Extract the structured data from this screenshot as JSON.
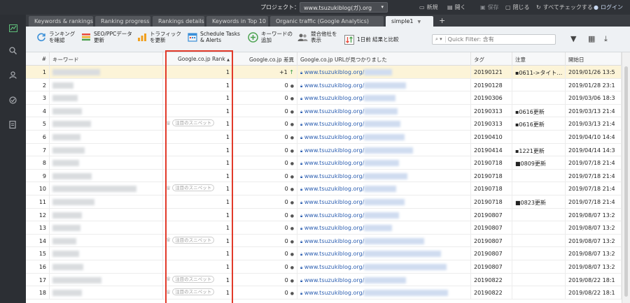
{
  "header": {
    "project_label": "プロジェクト：",
    "project_value": "www.tsuzukiblog(ガ).org",
    "buttons": [
      {
        "icon": "new-icon",
        "label": "新規"
      },
      {
        "icon": "open-icon",
        "label": "開く"
      },
      {
        "icon": "save-icon",
        "label": "保存"
      },
      {
        "icon": "close-icon",
        "label": "閉じる"
      },
      {
        "icon": "refresh-icon",
        "label": "すべてチェックする"
      },
      {
        "icon": "user-icon",
        "label": "ログイン"
      }
    ]
  },
  "sidebar": {
    "items": [
      {
        "icon": "chart-icon",
        "active": true
      },
      {
        "icon": "search-icon",
        "active": false
      },
      {
        "icon": "person-icon",
        "active": false
      },
      {
        "icon": "check-circle-icon",
        "active": false
      },
      {
        "icon": "document-icon",
        "active": false
      }
    ]
  },
  "tabs": [
    {
      "label": "Keywords & rankings",
      "active": false
    },
    {
      "label": "Ranking progress",
      "active": false
    },
    {
      "label": "Rankings details",
      "active": false
    },
    {
      "label": "Keywords in Top 10",
      "active": false
    },
    {
      "label": "Organic traffic (Google Analytics)",
      "active": false
    },
    {
      "label": "simple1",
      "active": true
    }
  ],
  "toolbar": {
    "buttons": [
      {
        "icon": "refresh-icon",
        "line1": "ランキング",
        "line2": "を確認"
      },
      {
        "icon": "seo-data-icon",
        "line1": "SEO/PPCデータ",
        "line2": "更新"
      },
      {
        "icon": "traffic-icon",
        "line1": "トラフィック",
        "line2": "を更新"
      },
      {
        "icon": "calendar-icon",
        "line1": "Schedule Tasks",
        "line2": "& Alerts"
      },
      {
        "icon": "add-keyword-icon",
        "line1": "キーワードの",
        "line2": "追加"
      },
      {
        "icon": "competitors-icon",
        "line1": "競合他社を",
        "line2": "表示"
      },
      {
        "icon": "compare-icon",
        "line1": "1日前 結果と比較",
        "line2": ""
      }
    ],
    "filter_mode": "",
    "filter_placeholder": "Quick Filter: 含有"
  },
  "table": {
    "columns": [
      "#",
      "キーワード",
      "Google.co.jp Rank",
      "Google.co.jp 差異",
      "Google.co.jp URLが見つかりました",
      "タグ",
      "注意",
      "開始日"
    ],
    "sort_indicator": "▲",
    "snippet_label": "注目のスニペット",
    "url_prefix": "www.tsuzukiblog.org/",
    "rows": [
      {
        "n": "1",
        "rank": "1",
        "diff": "+1",
        "up": true,
        "snippet": false,
        "tag": "20190121",
        "note": "▪0611->タイト…",
        "date": "2019/01/26 13:5"
      },
      {
        "n": "2",
        "rank": "1",
        "diff": "0",
        "up": false,
        "snippet": false,
        "tag": "20190128",
        "note": "",
        "date": "2019/01/28 23:1"
      },
      {
        "n": "3",
        "rank": "1",
        "diff": "0",
        "up": false,
        "snippet": false,
        "tag": "20190306",
        "note": "",
        "date": "2019/03/06 18:3"
      },
      {
        "n": "4",
        "rank": "1",
        "diff": "0",
        "up": false,
        "snippet": false,
        "tag": "20190313",
        "note": "▪0616更新",
        "date": "2019/03/13 21:4"
      },
      {
        "n": "5",
        "rank": "1",
        "diff": "0",
        "up": false,
        "snippet": true,
        "tag": "20190313",
        "note": "▪0616更新",
        "date": "2019/03/13 21:4"
      },
      {
        "n": "6",
        "rank": "1",
        "diff": "0",
        "up": false,
        "snippet": false,
        "tag": "20190410",
        "note": "",
        "date": "2019/04/10 14:4"
      },
      {
        "n": "7",
        "rank": "1",
        "diff": "0",
        "up": false,
        "snippet": false,
        "tag": "20190414",
        "note": "▪1221更新",
        "date": "2019/04/14 14:3"
      },
      {
        "n": "8",
        "rank": "1",
        "diff": "0",
        "up": false,
        "snippet": false,
        "tag": "20190718",
        "note": "■0809更新",
        "date": "2019/07/18 21:4"
      },
      {
        "n": "9",
        "rank": "1",
        "diff": "0",
        "up": false,
        "snippet": false,
        "tag": "20190718",
        "note": "",
        "date": "2019/07/18 21:4"
      },
      {
        "n": "10",
        "rank": "1",
        "diff": "0",
        "up": false,
        "snippet": true,
        "tag": "20190718",
        "note": "",
        "date": "2019/07/18 21:4"
      },
      {
        "n": "11",
        "rank": "1",
        "diff": "0",
        "up": false,
        "snippet": false,
        "tag": "20190718",
        "note": "■0823更新",
        "date": "2019/07/18 21:4"
      },
      {
        "n": "12",
        "rank": "1",
        "diff": "0",
        "up": false,
        "snippet": false,
        "tag": "20190807",
        "note": "",
        "date": "2019/08/07 13:2"
      },
      {
        "n": "13",
        "rank": "1",
        "diff": "0",
        "up": false,
        "snippet": false,
        "tag": "20190807",
        "note": "",
        "date": "2019/08/07 13:2"
      },
      {
        "n": "14",
        "rank": "1",
        "diff": "0",
        "up": false,
        "snippet": true,
        "tag": "20190807",
        "note": "",
        "date": "2019/08/07 13:2"
      },
      {
        "n": "15",
        "rank": "1",
        "diff": "0",
        "up": false,
        "snippet": false,
        "tag": "20190807",
        "note": "",
        "date": "2019/08/07 13:2"
      },
      {
        "n": "16",
        "rank": "1",
        "diff": "0",
        "up": false,
        "snippet": false,
        "tag": "20190807",
        "note": "",
        "date": "2019/08/07 13:2"
      },
      {
        "n": "17",
        "rank": "1",
        "diff": "0",
        "up": false,
        "snippet": true,
        "tag": "20190822",
        "note": "",
        "date": "2019/08/22 18:1"
      },
      {
        "n": "18",
        "rank": "1",
        "diff": "0",
        "up": false,
        "snippet": true,
        "tag": "20190822",
        "note": "",
        "date": "2019/08/22 18:1"
      }
    ]
  },
  "colors": {
    "highlight_box": "#e23a2a",
    "selected_row": "#fcf4d8",
    "url_link": "#2a5db0",
    "up_arrow": "#2f9a3c"
  }
}
